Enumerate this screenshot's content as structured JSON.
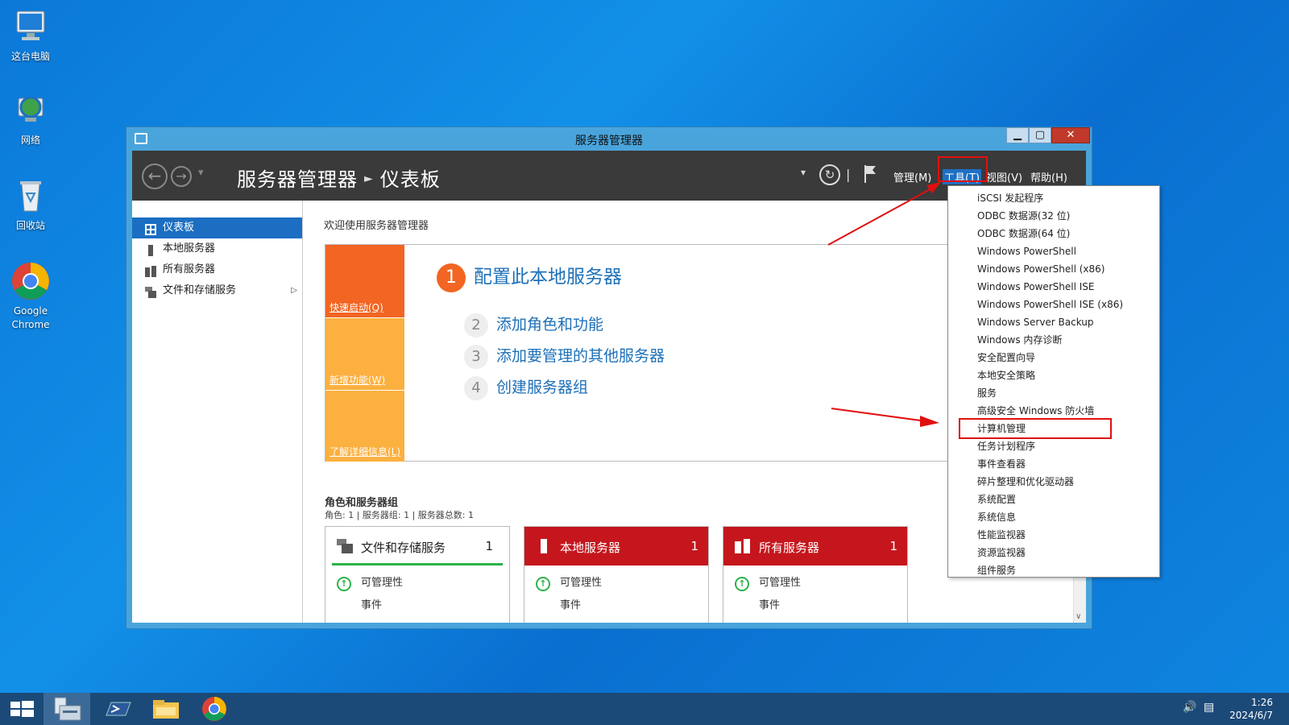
{
  "desktop": {
    "icons": [
      {
        "label": "这台电脑",
        "icon": "computer-icon"
      },
      {
        "label": "网络",
        "icon": "network-icon"
      },
      {
        "label": "回收站",
        "icon": "recycle-bin-icon"
      },
      {
        "label": "Google Chrome",
        "icon": "chrome-icon"
      }
    ]
  },
  "window": {
    "title": "服务器管理器",
    "controls": {
      "minimize": "▁",
      "maximize": "▢",
      "close": "✕"
    },
    "breadcrumb": {
      "app": "服务器管理器",
      "page": "仪表板"
    },
    "menus": {
      "manage": "管理(M)",
      "tools": "工具(T)",
      "view": "视图(V)",
      "help": "帮助(H)"
    },
    "nav": [
      {
        "label": "仪表板",
        "selected": true
      },
      {
        "label": "本地服务器"
      },
      {
        "label": "所有服务器"
      },
      {
        "label": "文件和存储服务",
        "has_children": true
      }
    ],
    "welcome": "欢迎使用服务器管理器",
    "tiles": {
      "quickstart": "快速启动(Q)",
      "whatsnew": "新增功能(W)",
      "learnmore": "了解详细信息(L)"
    },
    "steps": [
      {
        "num": "1",
        "label": "配置此本地服务器"
      },
      {
        "num": "2",
        "label": "添加角色和功能"
      },
      {
        "num": "3",
        "label": "添加要管理的其他服务器"
      },
      {
        "num": "4",
        "label": "创建服务器组"
      }
    ],
    "roles": {
      "title": "角色和服务器组",
      "summary": "角色: 1 | 服务器组: 1 | 服务器总数: 1",
      "cards": [
        {
          "title": "文件和存储服务",
          "count": "1",
          "manageability": "可管理性",
          "events": "事件"
        },
        {
          "title": "本地服务器",
          "count": "1",
          "manageability": "可管理性",
          "events": "事件"
        },
        {
          "title": "所有服务器",
          "count": "1",
          "manageability": "可管理性",
          "events": "事件"
        }
      ]
    }
  },
  "tools_menu": [
    "iSCSI 发起程序",
    "ODBC 数据源(32 位)",
    "ODBC 数据源(64 位)",
    "Windows PowerShell",
    "Windows PowerShell (x86)",
    "Windows PowerShell ISE",
    "Windows PowerShell ISE (x86)",
    "Windows Server Backup",
    "Windows 内存诊断",
    "安全配置向导",
    "本地安全策略",
    "服务",
    "高级安全 Windows 防火墙",
    "计算机管理",
    "任务计划程序",
    "事件查看器",
    "碎片整理和优化驱动器",
    "系统配置",
    "系统信息",
    "性能监视器",
    "资源监视器",
    "组件服务"
  ],
  "taskbar": {
    "time": "1:26",
    "date": "2024/6/7",
    "items": [
      "start-icon",
      "server-manager-icon",
      "powershell-icon",
      "file-explorer-icon",
      "chrome-icon"
    ]
  },
  "colors": {
    "accent_orange": "#f26522",
    "tile_yellow": "#fbb040",
    "link_blue": "#1d70b8",
    "alert_red": "#c5161d",
    "ok_green": "#2cb34a",
    "annotation_red": "#e01010"
  }
}
